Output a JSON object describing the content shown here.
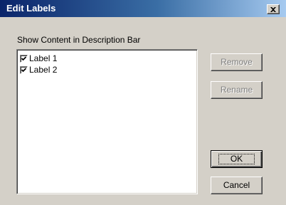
{
  "window": {
    "title": "Edit Labels",
    "close_glyph": "✕"
  },
  "section": {
    "label": "Show Content in Description Bar"
  },
  "labels": [
    {
      "text": "Label 1",
      "checked": true
    },
    {
      "text": "Label 2",
      "checked": true
    }
  ],
  "buttons": {
    "remove": {
      "label": "Remove",
      "enabled": false
    },
    "rename": {
      "label": "Rename",
      "enabled": false
    },
    "ok": {
      "label": "OK",
      "enabled": true,
      "default": true
    },
    "cancel": {
      "label": "Cancel",
      "enabled": true
    }
  },
  "colors": {
    "dialog_bg": "#d4d0c8",
    "titlebar_start": "#0a246a",
    "titlebar_end": "#a6caf0",
    "disabled_text": "#808080"
  },
  "icons": {
    "close": "close-icon",
    "checkmark": "checkmark-icon"
  }
}
